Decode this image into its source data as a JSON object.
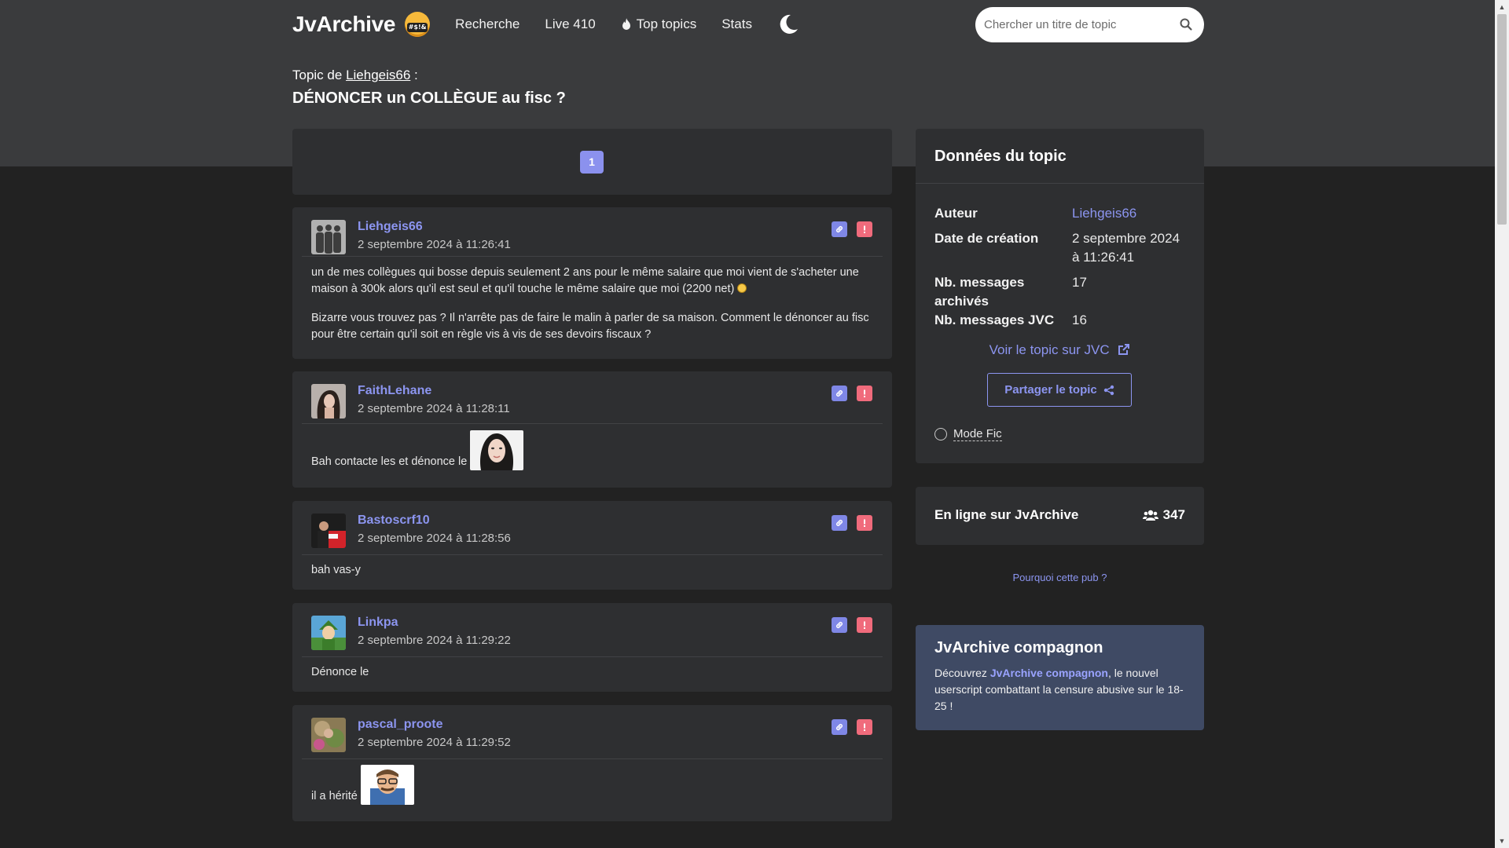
{
  "nav": {
    "brand": "JvArchive",
    "emoji_text": "#$!&",
    "links": [
      "Recherche",
      "Live 410",
      "Top topics",
      "Stats"
    ],
    "search_placeholder": "Chercher un titre de topic"
  },
  "topic": {
    "by_prefix": "Topic de",
    "author": "Liehgeis66",
    "by_suffix": ":",
    "title": "DÉNONCER un COLLÈGUE au fisc ?"
  },
  "pagination": {
    "current": "1"
  },
  "posts": [
    {
      "author": "Liehgeis66",
      "date": "2 septembre 2024 à 11:26:41",
      "paragraphs": [
        "un de mes collègues qui bosse depuis seulement 2 ans pour le même salaire que moi vient de s'acheter une maison à 300k alors qu'il est seul et qu'il touche le même salaire que moi (2200 net)",
        "Bizarre vous trouvez pas ? Il n'arrête pas de faire le malin à parler de sa maison. Comment le dénoncer au fisc pour être certain qu'il soit en règle vis à vis de ses devoirs fiscaux ?"
      ]
    },
    {
      "author": "FaithLehane",
      "date": "2 septembre 2024 à 11:28:11",
      "text": "Bah contacte les et dénonce le"
    },
    {
      "author": "Bastoscrf10",
      "date": "2 septembre 2024 à 11:28:56",
      "text": "bah vas-y"
    },
    {
      "author": "Linkpa",
      "date": "2 septembre 2024 à 11:29:22",
      "text": "Dénonce le"
    },
    {
      "author": "pascal_proote",
      "date": "2 septembre 2024 à 11:29:52",
      "text": "il a hérité"
    }
  ],
  "sidebar": {
    "data_title": "Données du topic",
    "rows": [
      {
        "key": "Auteur",
        "value": "Liehgeis66"
      },
      {
        "key": "Date de création",
        "value": "2 septembre 2024 à 11:26:41"
      },
      {
        "key": "Nb. messages archivés",
        "value": "17"
      },
      {
        "key": "Nb. messages JVC",
        "value": "16"
      }
    ],
    "jvc_link": "Voir le topic sur JVC",
    "share_label": "Partager le topic",
    "mode_fic": "Mode Fic",
    "online_title": "En ligne sur JvArchive",
    "online_count": "347",
    "why_pub": "Pourquoi cette pub ?",
    "companion_title": "JvArchive compagnon",
    "companion_pre": "Découvrez",
    "companion_link": "JvArchive compagnon",
    "companion_post": ", le nouvel userscript combattant la censure abusive sur le 18-25 !"
  },
  "colors": {
    "accent": "#8c95f0",
    "report": "#f06b7c",
    "header_bg": "#3a3b3d",
    "page_bg": "#222222",
    "card_bg": "#2e2f31",
    "companion_bg": "#3f4a64"
  }
}
